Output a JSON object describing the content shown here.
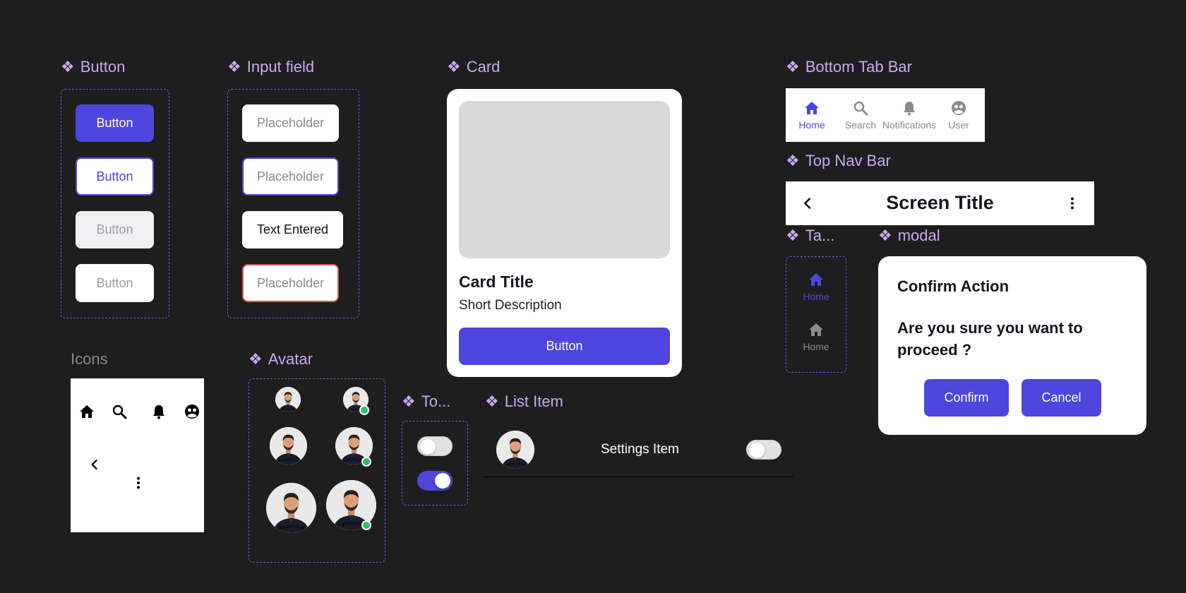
{
  "sections": {
    "button": "Button",
    "input_field": "Input field",
    "card": "Card",
    "bottom_tab_bar": "Bottom Tab Bar",
    "top_nav_bar": "Top Nav Bar",
    "tab_truncated": "Ta...",
    "modal": "modal",
    "icons": "Icons",
    "avatar": "Avatar",
    "toggle_truncated": "To...",
    "list_item": "List Item"
  },
  "component_glyph": "❖",
  "buttons": [
    {
      "label": "Button",
      "variant": "primary"
    },
    {
      "label": "Button",
      "variant": "outline"
    },
    {
      "label": "Button",
      "variant": "disabled"
    },
    {
      "label": "Button",
      "variant": "white"
    }
  ],
  "inputs": [
    {
      "text": "Placeholder",
      "state": "default"
    },
    {
      "text": "Placeholder",
      "state": "focused"
    },
    {
      "text": "Text Entered",
      "state": "filled"
    },
    {
      "text": "Placeholder",
      "state": "error"
    }
  ],
  "card": {
    "title": "Card Title",
    "description": "Short Description",
    "button_label": "Button"
  },
  "bottom_tabs": [
    {
      "label": "Home",
      "icon": "home-icon",
      "active": true
    },
    {
      "label": "Search",
      "icon": "search-icon",
      "active": false
    },
    {
      "label": "Notifications",
      "icon": "bell-icon",
      "active": false
    },
    {
      "label": "User",
      "icon": "user-icon",
      "active": false
    }
  ],
  "top_nav": {
    "title": "Screen Title",
    "back_icon": "chevron-left-icon",
    "menu_icon": "more-vertical-icon"
  },
  "tab_items": [
    {
      "label": "Home",
      "active": true
    },
    {
      "label": "Home",
      "active": false
    }
  ],
  "modal": {
    "title": "Confirm Action",
    "body": "Are you sure you want to proceed ?",
    "confirm_label": "Confirm",
    "cancel_label": "Cancel"
  },
  "icons_sheet": [
    "home-icon",
    "search-icon",
    "bell-icon",
    "user-icon",
    "chevron-left-icon",
    "more-vertical-icon"
  ],
  "list_item": {
    "label": "Settings Item",
    "toggle_on": false
  },
  "toggles": [
    {
      "on": false
    },
    {
      "on": true
    }
  ],
  "colors": {
    "background": "#1e1e1e",
    "accent": "#4e46dc",
    "label": "#c9a8f5",
    "error": "#e05252",
    "online": "#31c065"
  }
}
